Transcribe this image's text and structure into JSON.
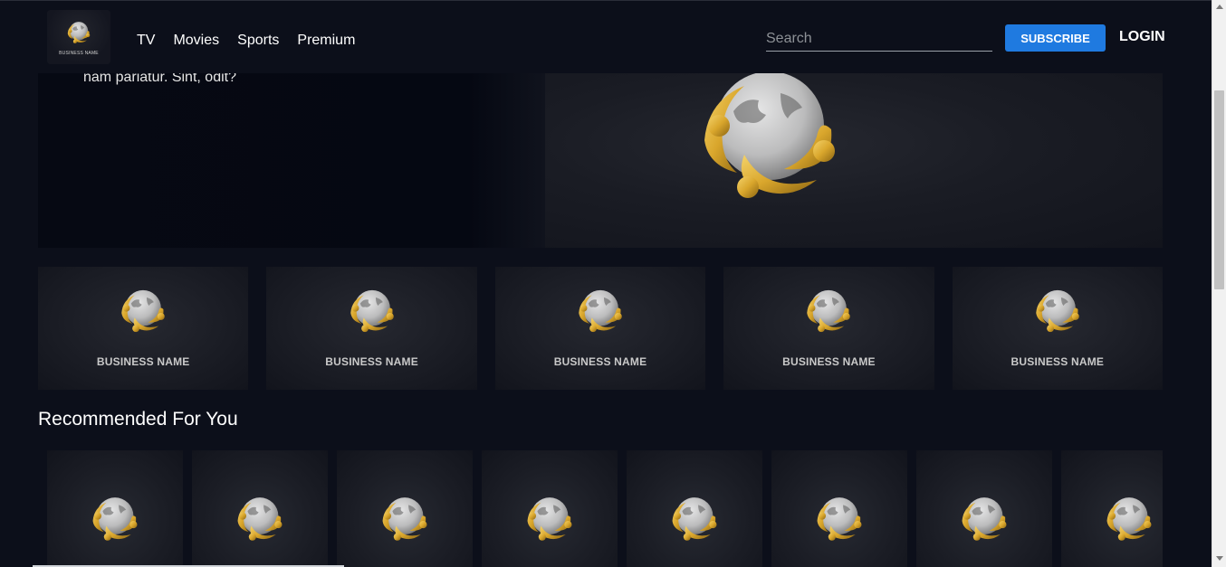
{
  "header": {
    "logo_caption": "BUSINESS NAME",
    "nav": [
      "TV",
      "Movies",
      "Sports",
      "Premium"
    ],
    "search_placeholder": "Search",
    "subscribe_label": "SUBSCRIBE",
    "login_label": "LOGIN"
  },
  "hero": {
    "text": "nam pariatur. Sint, odit?"
  },
  "business_cards": [
    {
      "name": "BUSINESS NAME"
    },
    {
      "name": "BUSINESS NAME"
    },
    {
      "name": "BUSINESS NAME"
    },
    {
      "name": "BUSINESS NAME"
    },
    {
      "name": "BUSINESS NAME"
    }
  ],
  "section": {
    "recommended_title": "Recommended For You"
  },
  "recommended_count": 8,
  "colors": {
    "background": "#0c0f1a",
    "accent": "#1f7ae0",
    "gold": "#d9a62c",
    "silver": "#d8d8d8"
  },
  "icons": {
    "logo": "globe-people-logo-icon"
  }
}
